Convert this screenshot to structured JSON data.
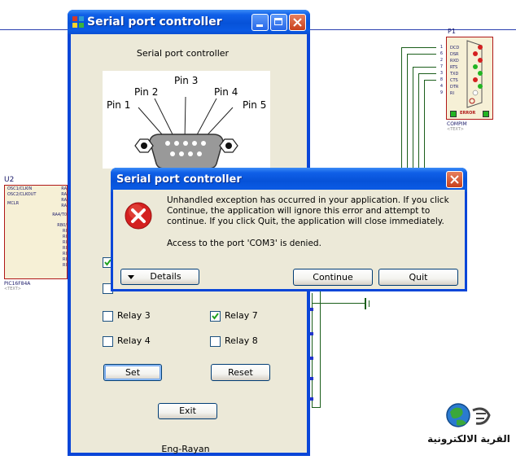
{
  "background": {
    "u2": {
      "ref": "U2",
      "pins_left": [
        "OSC1/CLKIN",
        "OSC2/CLKOUT",
        "MCLR"
      ],
      "pins_right_partial": [
        "RA",
        "RA",
        "RA",
        "RA",
        "RA4/T0",
        "RB0/",
        "RI",
        "RI",
        "RI",
        "RI",
        "RI",
        "RI",
        "RI"
      ],
      "part": "PIC16F84A",
      "text": "<TEXT>"
    },
    "p1": {
      "ref": "P1",
      "pins": [
        {
          "num": "1",
          "name": "DCD",
          "led": "red"
        },
        {
          "num": "6",
          "name": "DSR",
          "led": "red"
        },
        {
          "num": "2",
          "name": "RXD",
          "led": "red"
        },
        {
          "num": "7",
          "name": "RTS",
          "led": "green"
        },
        {
          "num": "3",
          "name": "TXD",
          "led": "green"
        },
        {
          "num": "8",
          "name": "CTS",
          "led": "red"
        },
        {
          "num": "4",
          "name": "DTR",
          "led": "green"
        },
        {
          "num": "9",
          "name": "RI",
          "led": "white"
        }
      ],
      "error_label": "ERROR",
      "part": "COMPIM",
      "text": "<TEXT>"
    },
    "logo": {
      "arabic_text": "القرية الالكترونية"
    }
  },
  "main_window": {
    "title": "Serial port controller",
    "heading": "Serial port controller",
    "pin_labels": [
      "Pin 1",
      "Pin 2",
      "Pin 3",
      "Pin 4",
      "Pin 5"
    ],
    "relays": [
      {
        "label": "Relay 3",
        "checked": false
      },
      {
        "label": "Relay 4",
        "checked": false
      },
      {
        "label": "Relay 7",
        "checked": true
      },
      {
        "label": "Relay 8",
        "checked": false
      }
    ],
    "set_label": "Set",
    "reset_label": "Reset",
    "exit_label": "Exit",
    "footer": "Eng-Rayan"
  },
  "dialog": {
    "title": "Serial port controller",
    "message": "Unhandled exception has occurred in your application. If you click Continue, the application will ignore this error and attempt to continue. If you click Quit, the application will close immediately.",
    "detail": "Access to the port 'COM3' is denied.",
    "details_label": "Details",
    "continue_label": "Continue",
    "quit_label": "Quit"
  },
  "colors": {
    "xp_title_blue": "#0a5ae4",
    "dialog_bg": "#ece9d8",
    "schematic_wire": "#1b5e1b",
    "component_border": "#b01818",
    "error_red": "#d42020"
  }
}
